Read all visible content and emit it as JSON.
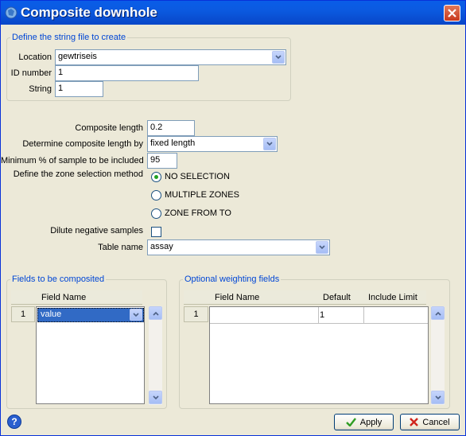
{
  "window": {
    "title": "Composite downhole"
  },
  "string_group": {
    "title": "Define the string file to create",
    "location_label": "Location",
    "location_value": "gewtriseis",
    "id_label": "ID number",
    "id_value": "1",
    "string_label": "String",
    "string_value": "1"
  },
  "params": {
    "composite_length_label": "Composite length",
    "composite_length_value": "0.2",
    "determine_label": "Determine composite length by",
    "determine_value": "fixed length",
    "min_pct_label": "Minimum % of sample to be included",
    "min_pct_value": "95",
    "zone_method_label": "Define the zone selection method",
    "zone_options": [
      "NO SELECTION",
      "MULTIPLE ZONES",
      "ZONE FROM TO"
    ],
    "zone_selected": "NO SELECTION",
    "dilute_label": "Dilute negative samples",
    "dilute_checked": false,
    "table_label": "Table name",
    "table_value": "assay"
  },
  "fields_group": {
    "title": "Fields to be composited",
    "col_header": "Field Name",
    "rows": [
      {
        "num": "1",
        "value": "value"
      }
    ]
  },
  "weight_group": {
    "title": "Optional weighting fields",
    "col_field": "Field Name",
    "col_default": "Default",
    "col_limit": "Include Limit",
    "rows": [
      {
        "num": "1",
        "field": "",
        "default": "1",
        "limit": ""
      }
    ]
  },
  "buttons": {
    "apply": "Apply",
    "cancel": "Cancel"
  },
  "colors": {
    "group_title": "#0046d5",
    "titlebar": "#0a5de8",
    "selection": "#316ac5"
  }
}
